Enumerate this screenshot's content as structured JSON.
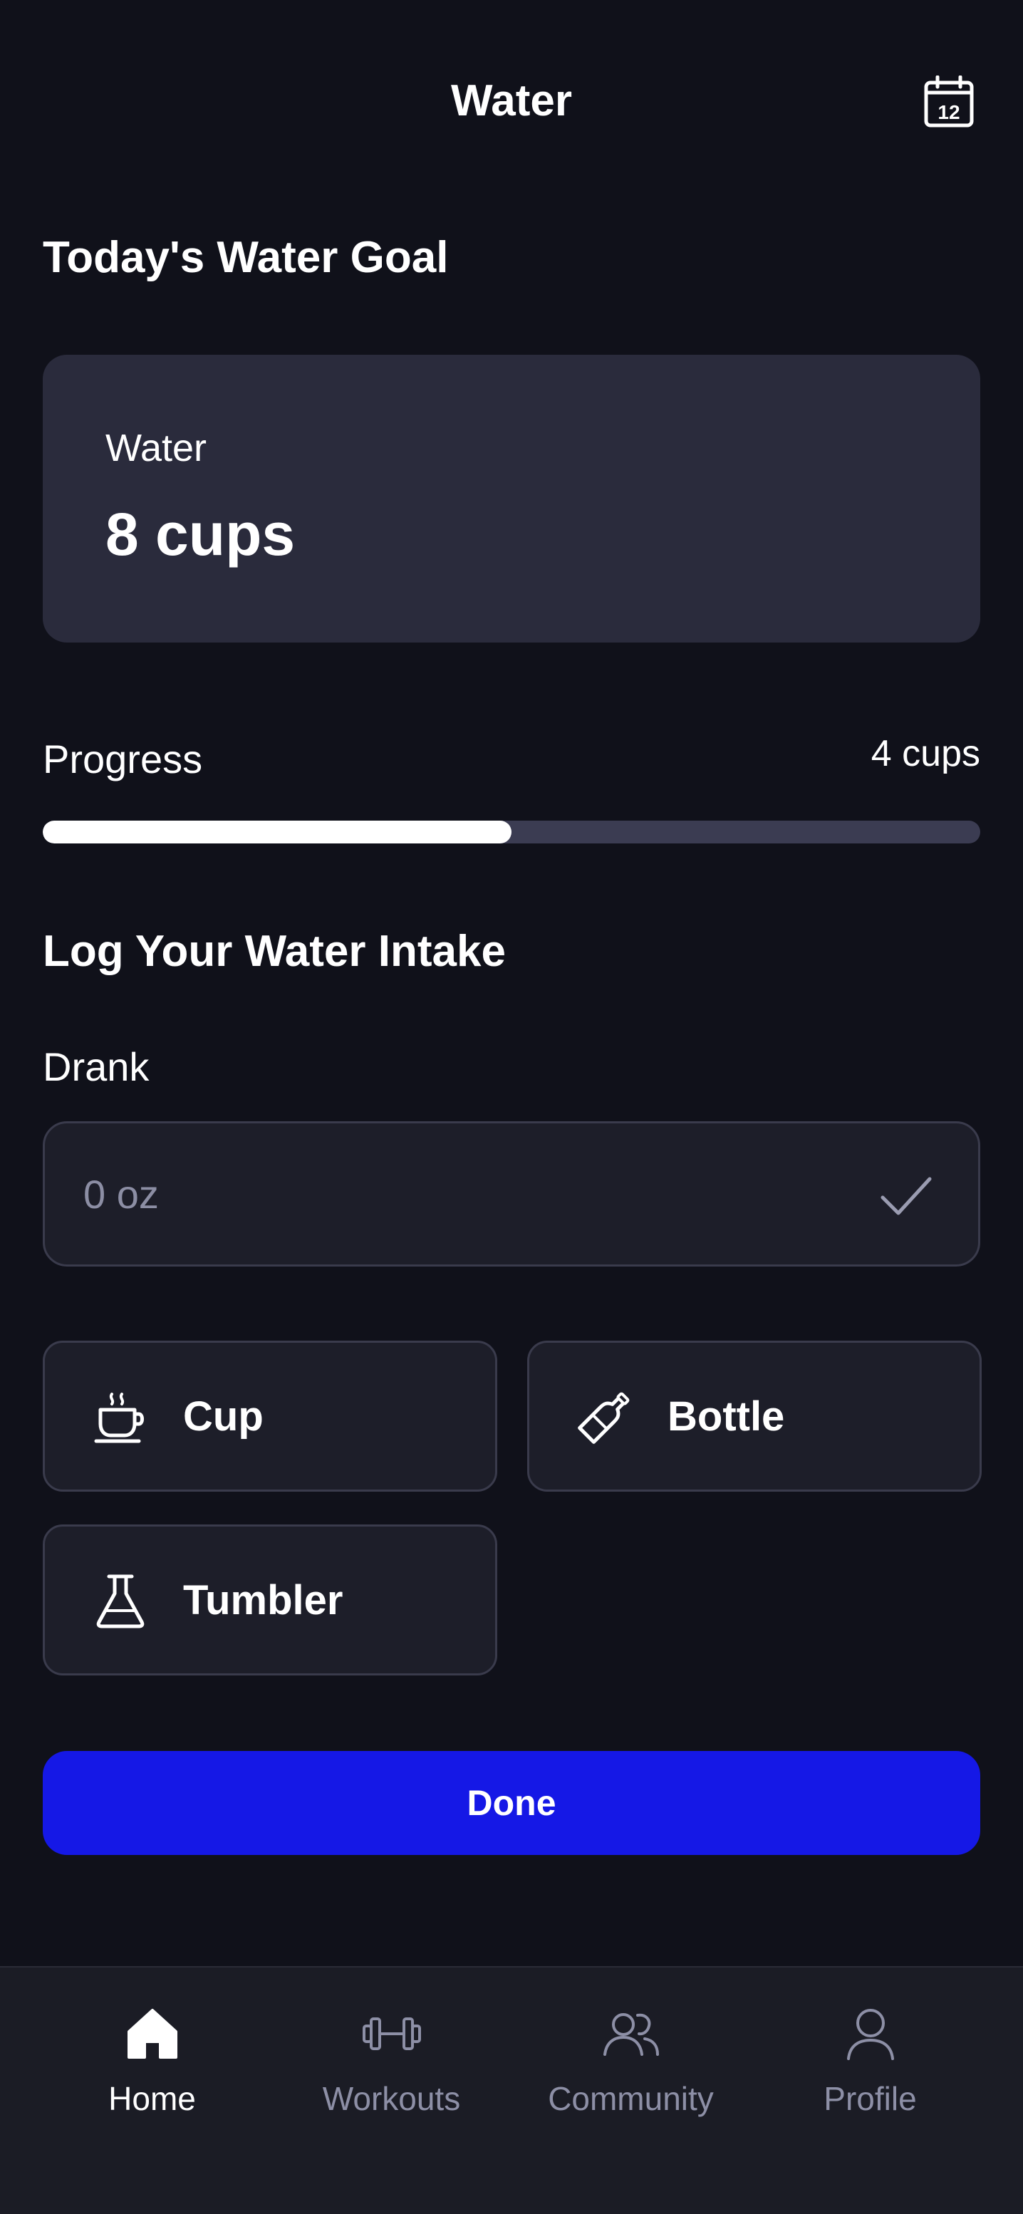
{
  "header": {
    "title": "Water",
    "calendar_day": "12"
  },
  "goal": {
    "section_title": "Today's Water Goal",
    "label": "Water",
    "value": "8 cups"
  },
  "progress": {
    "label": "Progress",
    "value_text": "4 cups",
    "fraction": 0.5
  },
  "log": {
    "section_title": "Log Your Water Intake",
    "field_label": "Drank",
    "placeholder": "0 oz",
    "value": ""
  },
  "containers": [
    {
      "label": "Cup",
      "icon": "cup-icon"
    },
    {
      "label": "Bottle",
      "icon": "bottle-icon"
    },
    {
      "label": "Tumbler",
      "icon": "flask-icon"
    }
  ],
  "done_label": "Done",
  "nav": {
    "active": "Home",
    "items": [
      {
        "label": "Home",
        "icon": "home-icon"
      },
      {
        "label": "Workouts",
        "icon": "dumbbell-icon"
      },
      {
        "label": "Community",
        "icon": "users-icon"
      },
      {
        "label": "Profile",
        "icon": "profile-icon"
      }
    ]
  },
  "colors": {
    "background": "#10111a",
    "card": "#2a2b3c",
    "accent": "#1518e6",
    "muted": "#8d8fa6"
  }
}
